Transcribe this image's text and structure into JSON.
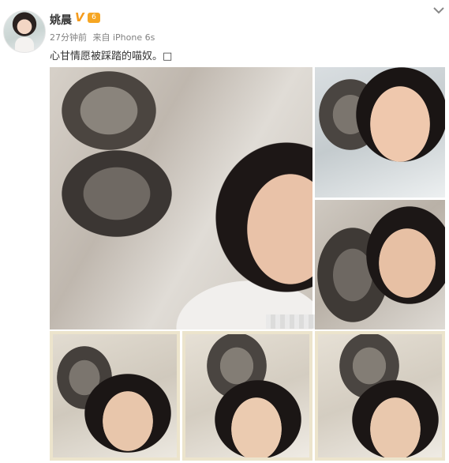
{
  "post": {
    "username": "姚晨",
    "verified_badge": "V",
    "level_badge": "6",
    "time": "27分钟前",
    "source": "来自 iPhone 6s",
    "text": "心甘情愿被踩踏的喵奴。□"
  },
  "photos": [
    {
      "id": "main",
      "subject": "woman-and-cat-selfie"
    },
    {
      "id": "right-top",
      "subject": "cat-on-face"
    },
    {
      "id": "right-bottom",
      "subject": "cat-paw-on-face"
    },
    {
      "id": "bottom-1",
      "subject": "selfie-with-cat"
    },
    {
      "id": "bottom-2",
      "subject": "selfie-with-cat"
    },
    {
      "id": "bottom-3",
      "subject": "selfie-with-cat"
    }
  ],
  "icons": {
    "menu": "chevron-down-icon",
    "verified": "verified-v-icon",
    "level": "vip-level-icon"
  },
  "colors": {
    "username": "#333333",
    "meta": "#808080",
    "badge": "#f59b1c"
  }
}
